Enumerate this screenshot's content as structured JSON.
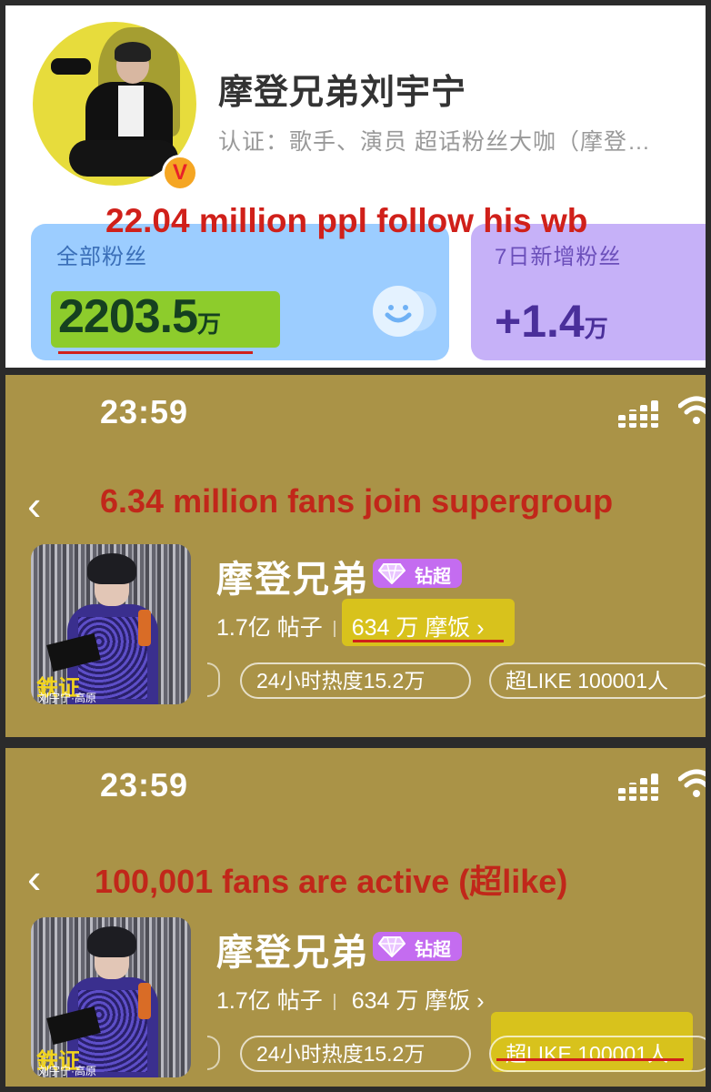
{
  "panel1": {
    "name": "摩登兄弟刘宇宁",
    "verification": "认证：歌手、演员 超话粉丝大咖（摩登…",
    "annotation": "22.04 million ppl follow his wb",
    "all_fans": {
      "label": "全部粉丝",
      "value": "2203.5",
      "unit": "万"
    },
    "new_fans_7d": {
      "label": "7日新增粉丝",
      "value": "+1.4",
      "unit": "万"
    },
    "verified_badge": "V"
  },
  "panel2": {
    "status_time": "23:59",
    "annotation": "6.34 million fans join supergroup",
    "back_icon": "‹",
    "group_name": "摩登兄弟",
    "tier_tag": "钻超",
    "posts": "1.7亿 帖子",
    "fans": "634 万 摩饭 ›",
    "heat": "24小时热度15.2万",
    "super_like": "超LIKE 100001人",
    "poster_title": "鉄证",
    "poster_subtitle": "刘宇宁·高原"
  },
  "panel3": {
    "status_time": "23:59",
    "annotation": "100,001 fans are active (超like)",
    "back_icon": "‹",
    "group_name": "摩登兄弟",
    "tier_tag": "钻超",
    "posts": "1.7亿 帖子",
    "fans": "634 万 摩饭 ›",
    "heat": "24小时热度15.2万",
    "super_like": "超LIKE 100001人",
    "poster_title": "鉄证",
    "poster_subtitle": "刘宇宁·高原"
  },
  "colors": {
    "annotation_red": "#d0201a",
    "highlight_yellow": "#d8c21c",
    "gold_background": "#aa9347",
    "fans_card_blue": "#9ccdff",
    "new_fans_card_purple": "#c6b1f8"
  }
}
